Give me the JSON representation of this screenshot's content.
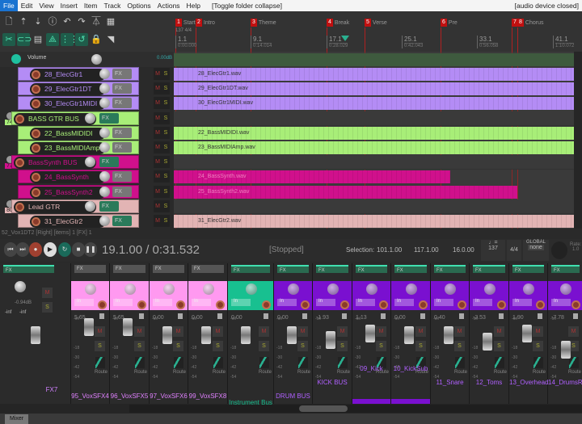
{
  "menu": {
    "items": [
      "File",
      "Edit",
      "View",
      "Insert",
      "Item",
      "Track",
      "Options",
      "Actions",
      "Help"
    ],
    "action_hint": "[Toggle folder collapse]",
    "audio_status": "[audio device closed]"
  },
  "toolbar": {
    "icons": [
      "new-file-icon",
      "save-icon",
      "open-icon",
      "info-icon",
      "undo-icon",
      "redo-icon",
      "metronome-icon",
      "grid-icon",
      "ripple-icon",
      "loop-icon",
      "snap-grid-icon",
      "auto-crossfade-icon",
      "grid-lines-icon",
      "envelope-lock-icon",
      "lock-icon",
      "trim-icon"
    ]
  },
  "ruler": {
    "tempo_sig": "137 4/4",
    "markers": [
      {
        "num": "1",
        "name": "Start"
      },
      {
        "num": "2",
        "name": "Intro"
      },
      {
        "num": "3",
        "name": "Theme"
      },
      {
        "num": "4",
        "name": "Break"
      },
      {
        "num": "5",
        "name": "Verse"
      },
      {
        "num": "6",
        "name": "Pre"
      },
      {
        "num": "7",
        "name": ""
      },
      {
        "num": "8",
        "name": "Chorus"
      }
    ],
    "ticks": [
      {
        "bar": "1.1",
        "time": "0:00.000"
      },
      {
        "bar": "9.1",
        "time": "0:14.014"
      },
      {
        "bar": "17.1",
        "time": "0:28.029"
      },
      {
        "bar": "25.1",
        "time": "0:42.043"
      },
      {
        "bar": "33.1",
        "time": "0:56.058"
      },
      {
        "bar": "41.1",
        "time": "1:10.072"
      }
    ]
  },
  "master": {
    "label": "Volume",
    "value": "0.00dB"
  },
  "tracks": [
    {
      "num": "71",
      "name": "28_ElecGtr1",
      "item": "28_ElecGtr1.wav",
      "color": "#b48cf5",
      "folder": false,
      "fx_on": false
    },
    {
      "num": "72",
      "name": "29_ElecGtr1DT",
      "item": "29_ElecGtr1DT.wav",
      "color": "#b48cf5",
      "folder": false,
      "fx_on": false
    },
    {
      "num": "73",
      "name": "30_ElecGtr1MIDI",
      "item": "30_ElecGtr1MIDI.wav",
      "color": "#b48cf5",
      "folder": false,
      "fx_on": false
    },
    {
      "num": "74",
      "name": "BASS GTR BUS",
      "item": "",
      "color": "#a8ee78",
      "folder": true,
      "fx_on": true
    },
    {
      "num": "75",
      "name": "22_BassMIDIDI",
      "item": "22_BassMIDIDI.wav",
      "color": "#a8ee78",
      "folder": false,
      "fx_on": false
    },
    {
      "num": "76",
      "name": "23_BassMIDIAmp",
      "item": "23_BassMIDIAmp.wav",
      "color": "#a8ee78",
      "folder": false,
      "fx_on": false
    },
    {
      "num": "77",
      "name": "BassSynth BUS",
      "item": "",
      "color": "#d0108c",
      "folder": true,
      "fx_on": true
    },
    {
      "num": "78",
      "name": "24_BassSynth",
      "item": "24_BassSynth.wav",
      "color": "#d0108c",
      "folder": false,
      "fx_on": false
    },
    {
      "num": "79",
      "name": "25_BassSynth2",
      "item": "25_BassSynth2.wav",
      "color": "#d0108c",
      "folder": false,
      "fx_on": false
    },
    {
      "num": "80",
      "name": "Lead GTR",
      "item": "",
      "color": "#e2b4b4",
      "folder": true,
      "fx_on": true
    },
    {
      "num": "81",
      "name": "31_ElecGtr2",
      "item": "31_ElecGtr2.wav",
      "color": "#e2b4b4",
      "folder": false,
      "fx_on": true
    }
  ],
  "status_line": "52_Vox1DT2 [Right] [items] 1 [FX] 1",
  "transport": {
    "position": "19.1.00 / 0:31.532",
    "state": "[Stopped]",
    "selection_label": "Selection:",
    "sel_start": "101.1.00",
    "sel_end": "117.1.00",
    "sel_length": "16.0.00",
    "bpm": "137",
    "time_sig": "4/4",
    "automation": "GLOBAL",
    "automation_mode": "none",
    "rate_label": "Rate:",
    "rate": "1.0"
  },
  "mixer": {
    "master_value": "-0.94dB",
    "master_peaks": [
      "-inf",
      "-inf"
    ],
    "fx_label": "FX",
    "in_label": "In",
    "route_label": "Route",
    "m_label": "M",
    "s_label": "S",
    "mixer_tab": "Mixer",
    "strips": [
      {
        "name": "FX7",
        "value": "",
        "color": "#2b2b2b",
        "label_color": "#d080ff"
      },
      {
        "name": "95_VoxSFX4",
        "value": "5.65",
        "color": "#ff99f0",
        "label_color": "#e080ff"
      },
      {
        "name": "96_VoxSFX5",
        "value": "5.65",
        "color": "#ff99f0",
        "label_color": "#e080ff"
      },
      {
        "name": "97_VoxSFX6",
        "value": "0.00",
        "color": "#ff99f0",
        "label_color": "#e080ff"
      },
      {
        "name": "99_VoxSFX8",
        "value": "0.00",
        "color": "#ff99f0",
        "label_color": "#e080ff"
      },
      {
        "name": "Instrument Bus",
        "value": "0.00",
        "color": "#18c090",
        "label_color": "#18c090"
      },
      {
        "name": "DRUM BUS",
        "value": "0.00",
        "color": "#7a10d0",
        "label_color": "#b060ff"
      },
      {
        "name": "KICK BUS",
        "value": "-1.93",
        "color": "#7a10d0",
        "label_color": "#b060ff"
      },
      {
        "name": "09_Kick",
        "value": "1.13",
        "color": "#7a10d0",
        "label_color": "#b060ff"
      },
      {
        "name": "10_KickSub",
        "value": "0.00",
        "color": "#7a10d0",
        "label_color": "#b060ff"
      },
      {
        "name": "11_Snare",
        "value": "0.40",
        "color": "#7a10d0",
        "label_color": "#b060ff"
      },
      {
        "name": "12_Toms",
        "value": "-3.53",
        "color": "#7a10d0",
        "label_color": "#b060ff"
      },
      {
        "name": "13_Overheads",
        "value": "1.90",
        "color": "#7a10d0",
        "label_color": "#b060ff"
      },
      {
        "name": "14_DrumsRo",
        "value": "-7.78",
        "color": "#7a10d0",
        "label_color": "#b060ff"
      }
    ]
  }
}
